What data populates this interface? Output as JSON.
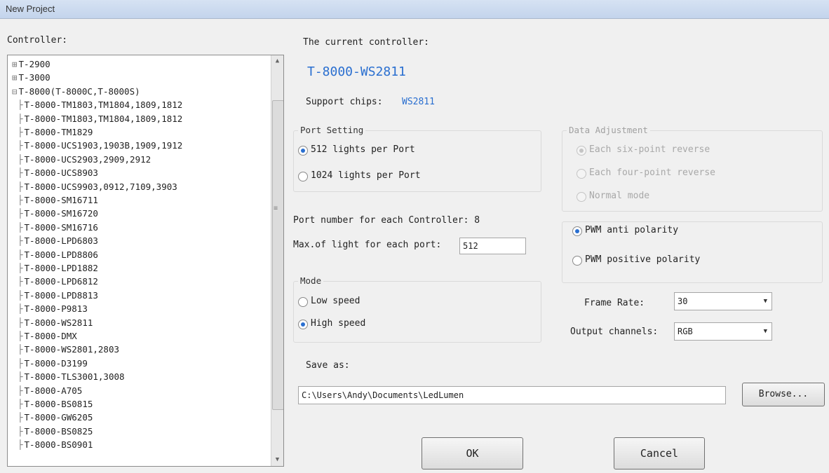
{
  "window": {
    "title": "New Project"
  },
  "controllers_label": "Controller:",
  "tree": [
    {
      "glyph": "⊞",
      "label": "T-2900",
      "indent": 1
    },
    {
      "glyph": "⊞",
      "label": "T-3000",
      "indent": 1
    },
    {
      "glyph": "⊟",
      "label": "T-8000(T-8000C,T-8000S)",
      "indent": 1
    },
    {
      "glyph": "├",
      "label": "T-8000-TM1803,TM1804,1809,1812",
      "indent": 2
    },
    {
      "glyph": "├",
      "label": "T-8000-TM1803,TM1804,1809,1812",
      "indent": 2
    },
    {
      "glyph": "├",
      "label": "T-8000-TM1829",
      "indent": 2
    },
    {
      "glyph": "├",
      "label": "T-8000-UCS1903,1903B,1909,1912",
      "indent": 2
    },
    {
      "glyph": "├",
      "label": "T-8000-UCS2903,2909,2912",
      "indent": 2
    },
    {
      "glyph": "├",
      "label": "T-8000-UCS8903",
      "indent": 2
    },
    {
      "glyph": "├",
      "label": "T-8000-UCS9903,0912,7109,3903",
      "indent": 2
    },
    {
      "glyph": "├",
      "label": "T-8000-SM16711",
      "indent": 2
    },
    {
      "glyph": "├",
      "label": "T-8000-SM16720",
      "indent": 2
    },
    {
      "glyph": "├",
      "label": "T-8000-SM16716",
      "indent": 2
    },
    {
      "glyph": "├",
      "label": "T-8000-LPD6803",
      "indent": 2
    },
    {
      "glyph": "├",
      "label": "T-8000-LPD8806",
      "indent": 2
    },
    {
      "glyph": "├",
      "label": "T-8000-LPD1882",
      "indent": 2
    },
    {
      "glyph": "├",
      "label": "T-8000-LPD6812",
      "indent": 2
    },
    {
      "glyph": "├",
      "label": "T-8000-LPD8813",
      "indent": 2
    },
    {
      "glyph": "├",
      "label": "T-8000-P9813",
      "indent": 2
    },
    {
      "glyph": "├",
      "label": "T-8000-WS2811",
      "indent": 2
    },
    {
      "glyph": "├",
      "label": "T-8000-DMX",
      "indent": 2
    },
    {
      "glyph": "├",
      "label": "T-8000-WS2801,2803",
      "indent": 2
    },
    {
      "glyph": "├",
      "label": "T-8000-D3199",
      "indent": 2
    },
    {
      "glyph": "├",
      "label": "T-8000-TLS3001,3008",
      "indent": 2
    },
    {
      "glyph": "├",
      "label": "T-8000-A705",
      "indent": 2
    },
    {
      "glyph": "├",
      "label": "T-8000-BS0815",
      "indent": 2
    },
    {
      "glyph": "├",
      "label": "T-8000-GW6205",
      "indent": 2
    },
    {
      "glyph": "├",
      "label": "T-8000-BS0825",
      "indent": 2
    },
    {
      "glyph": "├",
      "label": "T-8000-BS0901",
      "indent": 2
    }
  ],
  "current": {
    "label": "The current controller:",
    "name": "T-8000-WS2811",
    "support_label": "Support chips:",
    "support_value": "WS2811"
  },
  "port_setting": {
    "legend": "Port Setting",
    "opt1": "512 lights per Port",
    "opt2": "1024 lights per Port"
  },
  "data_adjustment": {
    "legend": "Data Adjustment",
    "opt1": "Each six-point reverse",
    "opt2": "Each four-point reverse",
    "opt3": "Normal mode"
  },
  "port_number_label": "Port number for each Controller: 8",
  "max_lights_label": "Max.of light for each port:",
  "max_lights_value": "512",
  "mode": {
    "legend": "Mode",
    "opt1": "Low speed",
    "opt2": "High speed"
  },
  "polarity": {
    "opt1": "PWM anti polarity",
    "opt2": "PWM positive polarity"
  },
  "frame_rate": {
    "label": "Frame Rate:",
    "value": "30"
  },
  "output_channel": {
    "label": "Output channels:",
    "value": "RGB"
  },
  "save": {
    "label": "Save as:",
    "path": "C:\\Users\\Andy\\Documents\\LedLumen",
    "browse": "Browse..."
  },
  "buttons": {
    "ok": "OK",
    "cancel": "Cancel"
  },
  "colors": {
    "accent_blue": "#2a6fd0",
    "titlebar": "#c9d8ee"
  }
}
